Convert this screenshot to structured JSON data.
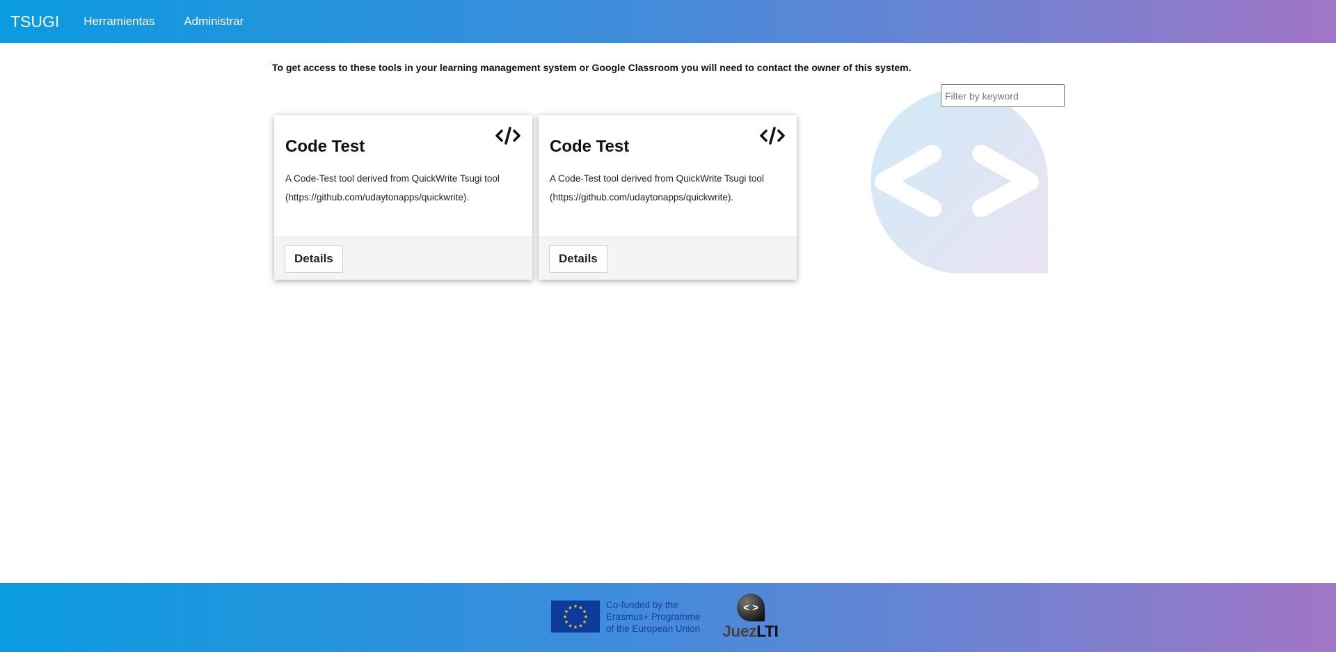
{
  "navbar": {
    "brand": "TSUGI",
    "links": [
      "Herramientas",
      "Administrar"
    ]
  },
  "notice": "To get access to these tools in your learning management system or Google Classroom you will need to contact the owner of this system.",
  "filter": {
    "placeholder": "Filter by keyword"
  },
  "cards": [
    {
      "title": "Code Test",
      "description_line1": "A Code-Test tool derived from QuickWrite Tsugi tool",
      "description_line2": "(https://github.com/udaytonapps/quickwrite).",
      "button": "Details",
      "icon": "code-icon"
    },
    {
      "title": "Code Test",
      "description_line1": "A Code-Test tool derived from QuickWrite Tsugi tool",
      "description_line2": "(https://github.com/udaytonapps/quickwrite).",
      "button": "Details",
      "icon": "code-icon"
    }
  ],
  "footer": {
    "eu_line1": "Co-funded by the",
    "eu_line2": "Erasmus+ Programme",
    "eu_line3": "of the European Union",
    "juez_part1": "Juez",
    "juez_part2": "LTI",
    "juez_icon_text": "< >"
  },
  "colors": {
    "gradient_start": "#0a9be0",
    "gradient_end": "#a275c6",
    "eu_blue": "#0d3a9b",
    "eu_star": "#ffd400"
  }
}
